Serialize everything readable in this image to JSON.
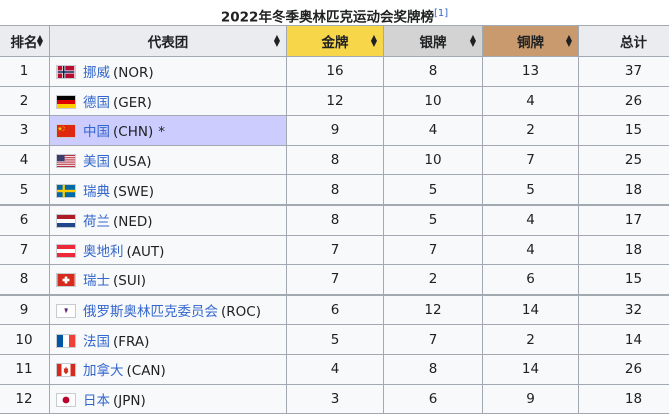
{
  "title": "2022年冬季奥林匹克运动会奖牌榜",
  "footnote": "[1]",
  "headers": {
    "rank": "排名",
    "nation": "代表团",
    "gold": "金牌",
    "silver": "银牌",
    "bronze": "铜牌",
    "total": "总计"
  },
  "sort_icon": "sort-arrows-icon",
  "colors": {
    "gold": "#f7d64a",
    "silver": "#d3d3d3",
    "bronze": "#c99a6d",
    "host": "#ccccff",
    "link": "#3366cc"
  },
  "rows": [
    {
      "rank": "1",
      "name": "挪威",
      "code": "(NOR)",
      "flag": "flag-norway-icon",
      "gold": "16",
      "silver": "8",
      "bronze": "13",
      "total": "37"
    },
    {
      "rank": "2",
      "name": "德国",
      "code": "(GER)",
      "flag": "flag-germany-icon",
      "gold": "12",
      "silver": "10",
      "bronze": "4",
      "total": "26"
    },
    {
      "rank": "3",
      "name": "中国",
      "code": "(CHN)",
      "flag": "flag-china-icon",
      "host_mark": "*",
      "gold": "9",
      "silver": "4",
      "bronze": "2",
      "total": "15"
    },
    {
      "rank": "4",
      "name": "美国",
      "code": "(USA)",
      "flag": "flag-usa-icon",
      "gold": "8",
      "silver": "10",
      "bronze": "7",
      "total": "25"
    },
    {
      "rank": "5",
      "name": "瑞典",
      "code": "(SWE)",
      "flag": "flag-sweden-icon",
      "gold": "8",
      "silver": "5",
      "bronze": "5",
      "total": "18"
    },
    {
      "rank": "6",
      "name": "荷兰",
      "code": "(NED)",
      "flag": "flag-netherlands-icon",
      "gold": "8",
      "silver": "5",
      "bronze": "4",
      "total": "17"
    },
    {
      "rank": "7",
      "name": "奥地利",
      "code": "(AUT)",
      "flag": "flag-austria-icon",
      "gold": "7",
      "silver": "7",
      "bronze": "4",
      "total": "18"
    },
    {
      "rank": "8",
      "name": "瑞士",
      "code": "(SUI)",
      "flag": "flag-switzerland-icon",
      "gold": "7",
      "silver": "2",
      "bronze": "6",
      "total": "15"
    },
    {
      "rank": "9",
      "name": "俄罗斯奥林匹克委员会",
      "code": "(ROC)",
      "flag": "flag-roc-icon",
      "gold": "6",
      "silver": "12",
      "bronze": "14",
      "total": "32"
    },
    {
      "rank": "10",
      "name": "法国",
      "code": "(FRA)",
      "flag": "flag-france-icon",
      "gold": "5",
      "silver": "7",
      "bronze": "2",
      "total": "14"
    },
    {
      "rank": "11",
      "name": "加拿大",
      "code": "(CAN)",
      "flag": "flag-canada-icon",
      "gold": "4",
      "silver": "8",
      "bronze": "14",
      "total": "26"
    },
    {
      "rank": "12",
      "name": "日本",
      "code": "(JPN)",
      "flag": "flag-japan-icon",
      "gold": "3",
      "silver": "6",
      "bronze": "9",
      "total": "18"
    }
  ]
}
